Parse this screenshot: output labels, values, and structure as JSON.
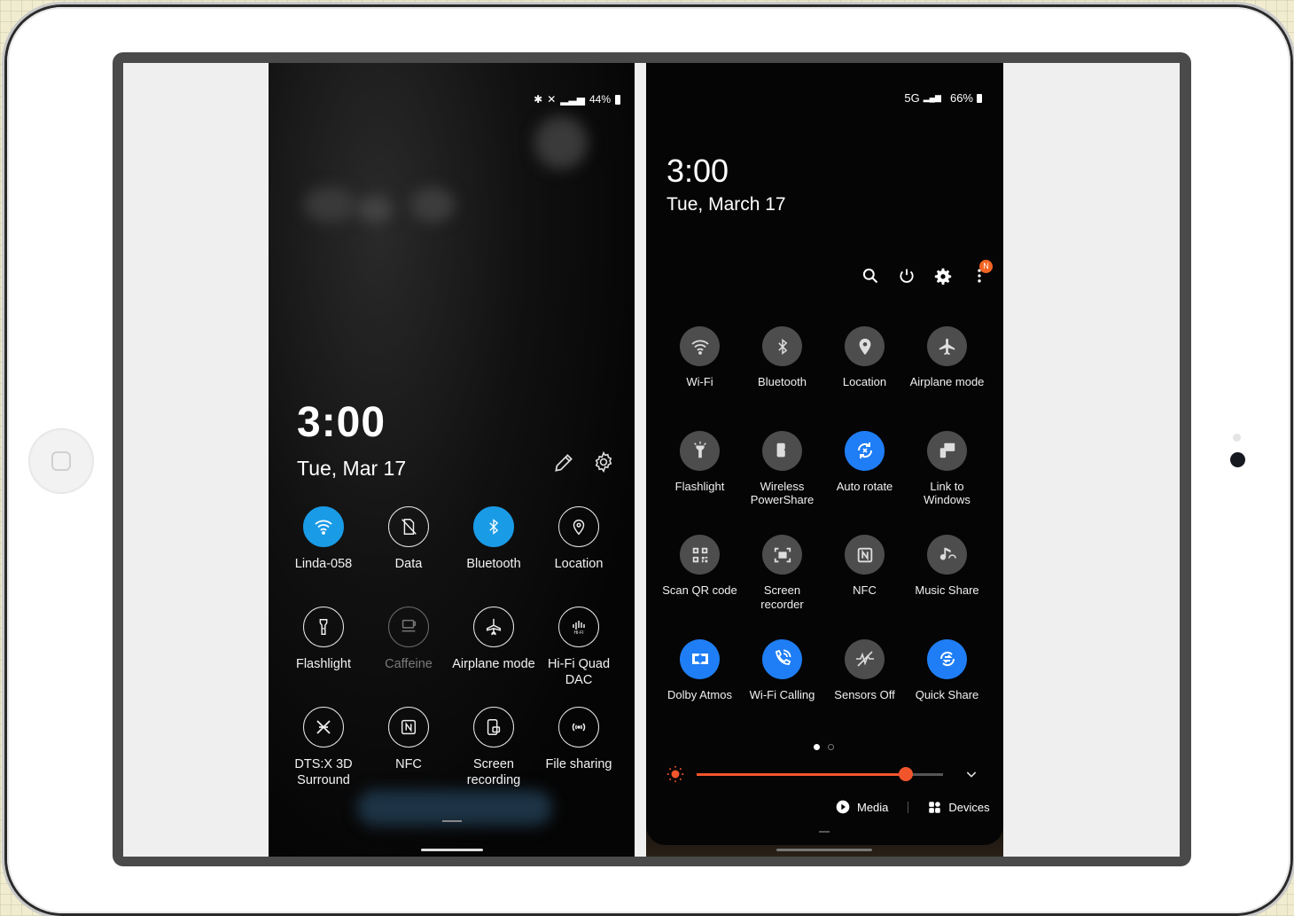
{
  "left_phone": {
    "status": {
      "battery": "44%"
    },
    "time": "3:00",
    "date": "Tue, Mar 17",
    "tiles": [
      {
        "label": "Linda-058",
        "icon": "wifi-icon",
        "state": "on"
      },
      {
        "label": "Data",
        "icon": "data-off-icon",
        "state": "off"
      },
      {
        "label": "Bluetooth",
        "icon": "bluetooth-icon",
        "state": "on"
      },
      {
        "label": "Location",
        "icon": "location-icon",
        "state": "off"
      },
      {
        "label": "Flashlight",
        "icon": "flashlight-icon",
        "state": "off"
      },
      {
        "label": "Caffeine",
        "icon": "caffeine-icon",
        "state": "disabled"
      },
      {
        "label": "Airplane mode",
        "icon": "airplane-icon",
        "state": "off"
      },
      {
        "label": "Hi-Fi Quad DAC",
        "icon": "hifi-icon",
        "state": "off"
      },
      {
        "label": "DTS:X 3D Surround",
        "icon": "dts-icon",
        "state": "off"
      },
      {
        "label": "NFC",
        "icon": "nfc-icon",
        "state": "off"
      },
      {
        "label": "Screen recording",
        "icon": "screen-recording-icon",
        "state": "off"
      },
      {
        "label": "File sharing",
        "icon": "file-sharing-icon",
        "state": "off"
      }
    ]
  },
  "right_phone": {
    "status": {
      "network": "5G",
      "battery": "66%"
    },
    "time": "3:00",
    "date": "Tue, March 17",
    "notification_badge": "N",
    "tiles": [
      {
        "label": "Wi-Fi",
        "icon": "wifi-icon",
        "state": "off"
      },
      {
        "label": "Bluetooth",
        "icon": "bluetooth-icon",
        "state": "off"
      },
      {
        "label": "Location",
        "icon": "location-icon",
        "state": "off"
      },
      {
        "label": "Airplane mode",
        "icon": "airplane-icon",
        "state": "off"
      },
      {
        "label": "Flashlight",
        "icon": "flashlight-icon",
        "state": "off"
      },
      {
        "label": "Wireless PowerShare",
        "icon": "powershare-icon",
        "state": "off"
      },
      {
        "label": "Auto rotate",
        "icon": "auto-rotate-icon",
        "state": "on"
      },
      {
        "label": "Link to Windows",
        "icon": "link-windows-icon",
        "state": "off"
      },
      {
        "label": "Scan QR code",
        "icon": "qr-icon",
        "state": "off"
      },
      {
        "label": "Screen recorder",
        "icon": "screen-recorder-icon",
        "state": "off"
      },
      {
        "label": "NFC",
        "icon": "nfc-icon",
        "state": "off"
      },
      {
        "label": "Music Share",
        "icon": "music-share-icon",
        "state": "off"
      },
      {
        "label": "Dolby Atmos",
        "icon": "dolby-icon",
        "state": "on"
      },
      {
        "label": "Wi-Fi Calling",
        "icon": "wifi-calling-icon",
        "state": "on"
      },
      {
        "label": "Sensors Off",
        "icon": "sensors-off-icon",
        "state": "off"
      },
      {
        "label": "Quick Share",
        "icon": "quick-share-icon",
        "state": "on"
      }
    ],
    "brightness": 0.85,
    "media_label": "Media",
    "devices_label": "Devices",
    "colors": {
      "accent": "#1f7ef5",
      "brightness": "#f2552c",
      "badge": "#f26522"
    }
  }
}
